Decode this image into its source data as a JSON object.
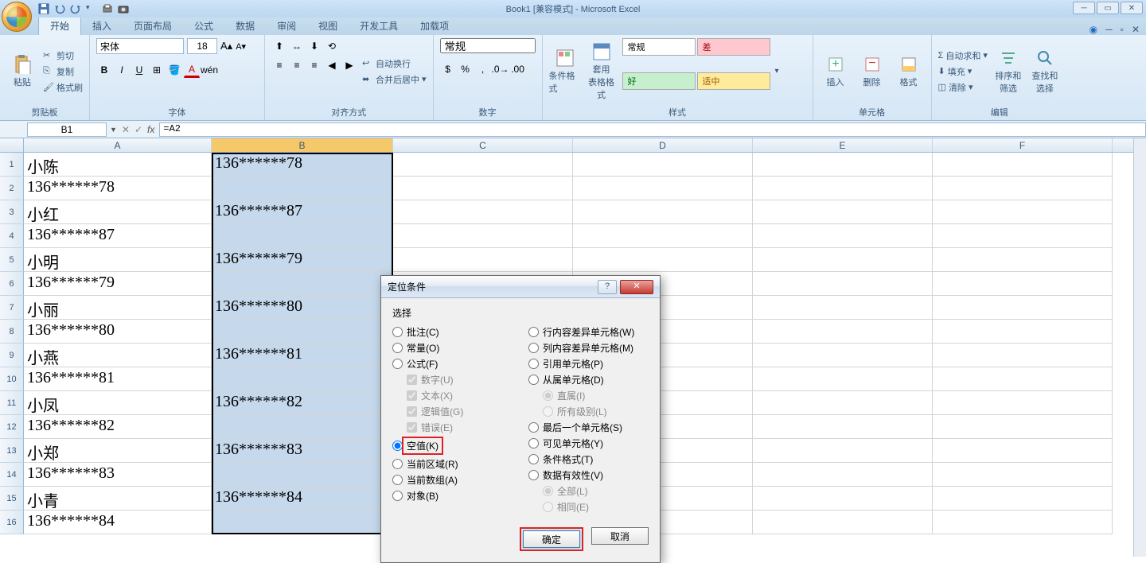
{
  "title": "Book1  [兼容模式] - Microsoft Excel",
  "qat": {
    "save": "save",
    "undo": "undo",
    "redo": "redo"
  },
  "tabs": [
    "开始",
    "插入",
    "页面布局",
    "公式",
    "数据",
    "审阅",
    "视图",
    "开发工具",
    "加载项"
  ],
  "active_tab": 0,
  "ribbon": {
    "clipboard": {
      "paste": "粘贴",
      "cut": "剪切",
      "copy": "复制",
      "format_painter": "格式刷",
      "label": "剪贴板"
    },
    "font": {
      "name": "宋体",
      "size": "18",
      "bold": "B",
      "italic": "I",
      "underline": "U",
      "label": "字体"
    },
    "align": {
      "wrap": "自动换行",
      "merge": "合并后居中",
      "label": "对齐方式"
    },
    "number": {
      "format": "常规",
      "label": "数字"
    },
    "styles": {
      "cond": "条件格式",
      "table": "套用\n表格格式",
      "s1": "常规",
      "s2": "差",
      "s3": "好",
      "s4": "适中",
      "label": "样式"
    },
    "cells": {
      "insert": "插入",
      "delete": "删除",
      "format": "格式",
      "label": "单元格"
    },
    "editing": {
      "sum": "自动求和",
      "fill": "填充",
      "clear": "清除",
      "sort": "排序和\n筛选",
      "find": "查找和\n选择",
      "label": "编辑"
    }
  },
  "namebox": "B1",
  "formula": "=A2",
  "columns": [
    "A",
    "B",
    "C",
    "D",
    "E",
    "F"
  ],
  "col_widths": {
    "A": 236,
    "B": 228,
    "C": 226,
    "D": 226,
    "E": 226,
    "F": 226
  },
  "rows": [
    {
      "n": 1,
      "A": "小陈",
      "B": "136******78"
    },
    {
      "n": 2,
      "A": "136******78",
      "B": ""
    },
    {
      "n": 3,
      "A": "小红",
      "B": "136******87"
    },
    {
      "n": 4,
      "A": "136******87",
      "B": ""
    },
    {
      "n": 5,
      "A": "小明",
      "B": "136******79"
    },
    {
      "n": 6,
      "A": "136******79",
      "B": ""
    },
    {
      "n": 7,
      "A": "小丽",
      "B": "136******80"
    },
    {
      "n": 8,
      "A": "136******80",
      "B": ""
    },
    {
      "n": 9,
      "A": "小燕",
      "B": "136******81"
    },
    {
      "n": 10,
      "A": "136******81",
      "B": ""
    },
    {
      "n": 11,
      "A": "小凤",
      "B": "136******82"
    },
    {
      "n": 12,
      "A": "136******82",
      "B": ""
    },
    {
      "n": 13,
      "A": "小郑",
      "B": "136******83"
    },
    {
      "n": 14,
      "A": "136******83",
      "B": ""
    },
    {
      "n": 15,
      "A": "小青",
      "B": "136******84"
    },
    {
      "n": 16,
      "A": "136******84",
      "B": ""
    }
  ],
  "dialog": {
    "title": "定位条件",
    "section": "选择",
    "left": {
      "comments": "批注(C)",
      "constants": "常量(O)",
      "formulas": "公式(F)",
      "numbers": "数字(U)",
      "text": "文本(X)",
      "logical": "逻辑值(G)",
      "errors": "错误(E)",
      "blanks": "空值(K)",
      "current_region": "当前区域(R)",
      "current_array": "当前数组(A)",
      "objects": "对象(B)"
    },
    "right": {
      "row_diff": "行内容差异单元格(W)",
      "col_diff": "列内容差异单元格(M)",
      "precedents": "引用单元格(P)",
      "dependents": "从属单元格(D)",
      "direct": "直属(I)",
      "all_levels": "所有级别(L)",
      "last_cell": "最后一个单元格(S)",
      "visible": "可见单元格(Y)",
      "cond_format": "条件格式(T)",
      "validation": "数据有效性(V)",
      "all": "全部(L)",
      "same": "相同(E)"
    },
    "ok": "确定",
    "cancel": "取消"
  }
}
